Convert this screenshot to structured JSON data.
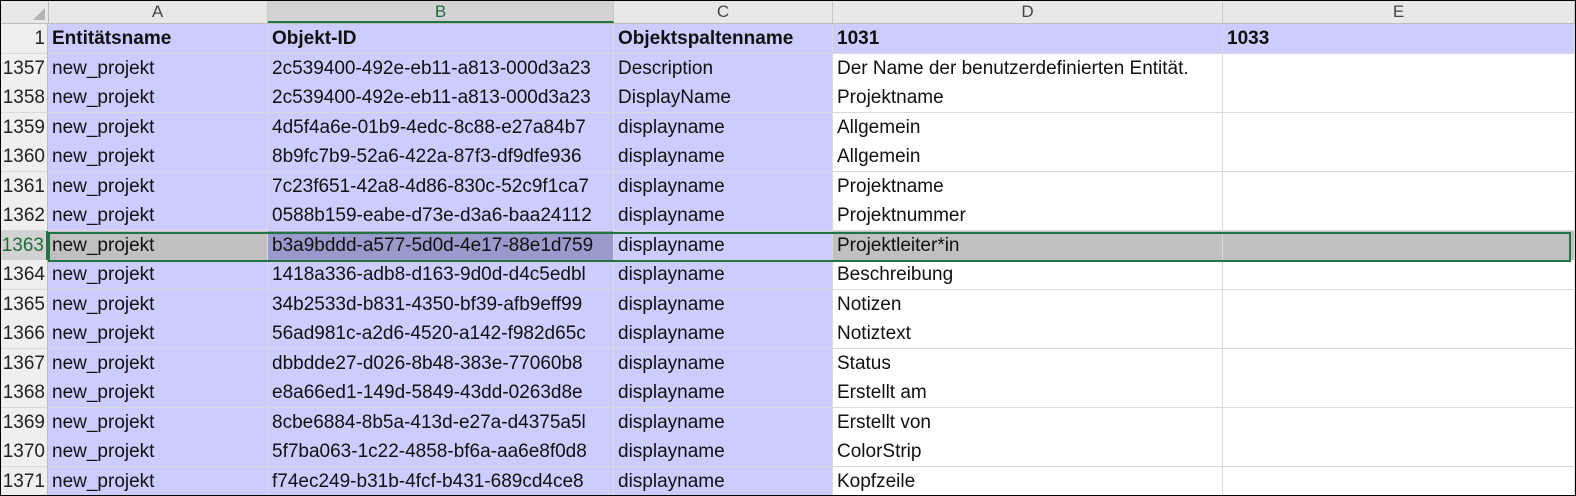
{
  "columns": [
    "A",
    "B",
    "C",
    "D",
    "E"
  ],
  "header_row": {
    "number": "1",
    "cells": [
      "Entitätsname",
      "Objekt-ID",
      "Objektspaltenname",
      "1031",
      "1033"
    ]
  },
  "active_row_number": "1363",
  "rows": [
    {
      "num": "1357",
      "a": "new_projekt",
      "b": "2c539400-492e-eb11-a813-000d3a23",
      "c": "Description",
      "d": "Der Name der benutzerdefinierten Entität.",
      "e": ""
    },
    {
      "num": "1358",
      "a": "new_projekt",
      "b": "2c539400-492e-eb11-a813-000d3a23",
      "c": "DisplayName",
      "d": "Projektname",
      "e": ""
    },
    {
      "num": "1359",
      "a": "new_projekt",
      "b": "4d5f4a6e-01b9-4edc-8c88-e27a84b7",
      "c": "displayname",
      "d": "Allgemein",
      "e": ""
    },
    {
      "num": "1360",
      "a": "new_projekt",
      "b": "8b9fc7b9-52a6-422a-87f3-df9dfe936",
      "c": "displayname",
      "d": "Allgemein",
      "e": ""
    },
    {
      "num": "1361",
      "a": "new_projekt",
      "b": "7c23f651-42a8-4d86-830c-52c9f1ca7",
      "c": "displayname",
      "d": "Projektname",
      "e": ""
    },
    {
      "num": "1362",
      "a": "new_projekt",
      "b": "0588b159-eabe-d73e-d3a6-baa24112",
      "c": "displayname",
      "d": "Projektnummer",
      "e": ""
    },
    {
      "num": "1363",
      "a": "new_projekt",
      "b": "b3a9bddd-a577-5d0d-4e17-88e1d759",
      "c": "displayname",
      "d": "Projektleiter*in",
      "e": ""
    },
    {
      "num": "1364",
      "a": "new_projekt",
      "b": "1418a336-adb8-d163-9d0d-d4c5edbl",
      "c": "displayname",
      "d": "Beschreibung",
      "e": ""
    },
    {
      "num": "1365",
      "a": "new_projekt",
      "b": "34b2533d-b831-4350-bf39-afb9eff99",
      "c": "displayname",
      "d": "Notizen",
      "e": ""
    },
    {
      "num": "1366",
      "a": "new_projekt",
      "b": "56ad981c-a2d6-4520-a142-f982d65c",
      "c": "displayname",
      "d": "Notiztext",
      "e": ""
    },
    {
      "num": "1367",
      "a": "new_projekt",
      "b": "dbbdde27-d026-8b48-383e-77060b8",
      "c": "displayname",
      "d": "Status",
      "e": ""
    },
    {
      "num": "1368",
      "a": "new_projekt",
      "b": "e8a66ed1-149d-5849-43dd-0263d8e",
      "c": "displayname",
      "d": "Erstellt am",
      "e": ""
    },
    {
      "num": "1369",
      "a": "new_projekt",
      "b": "8cbe6884-8b5a-413d-e27a-d4375a5l",
      "c": "displayname",
      "d": "Erstellt von",
      "e": ""
    },
    {
      "num": "1370",
      "a": "new_projekt",
      "b": "5f7ba063-1c22-4858-bf6a-aa6e8f0d8",
      "c": "displayname",
      "d": "ColorStrip",
      "e": ""
    },
    {
      "num": "1371",
      "a": "new_projekt",
      "b": "f74ec249-b31b-4fcf-b431-689cd4ce8",
      "c": "displayname",
      "d": "Kopfzeile",
      "e": ""
    }
  ],
  "colors": {
    "header_fill": "#ccccff",
    "tinted_column_fill": "#ccccff",
    "active_row_fill": "#c0c0c0",
    "selected_cell_fill": "#9999cc",
    "selection_border": "#217346"
  }
}
